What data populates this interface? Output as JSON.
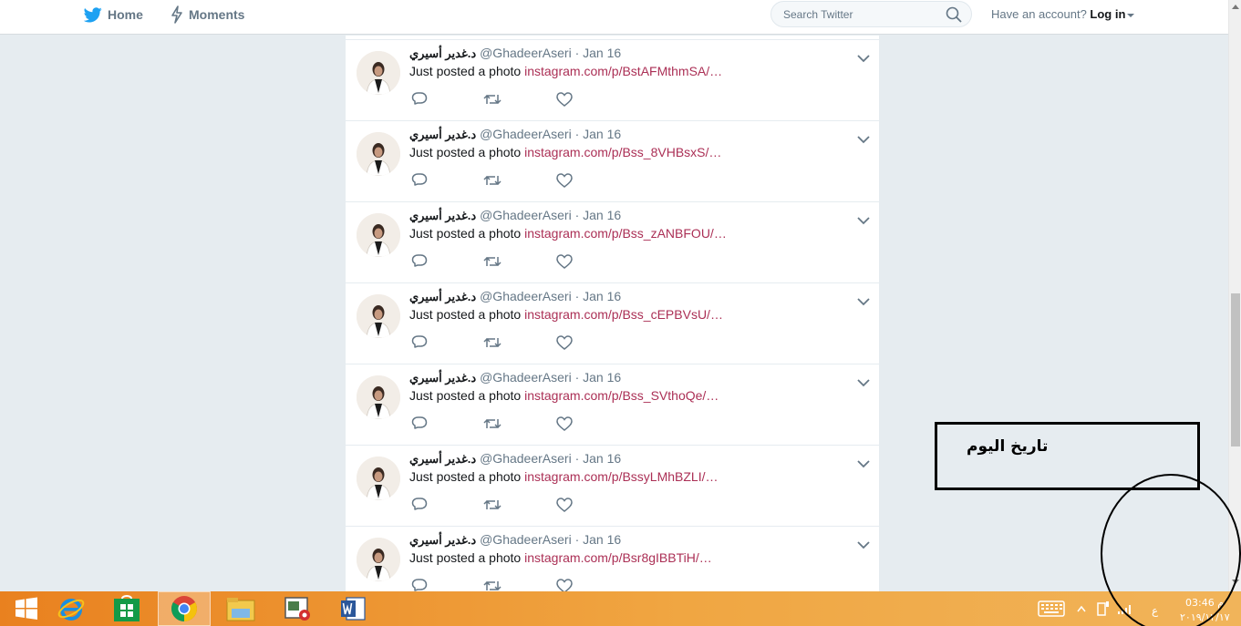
{
  "nav": {
    "home_label": "Home",
    "moments_label": "Moments",
    "search_placeholder": "Search Twitter",
    "account_prompt": "Have an account?",
    "login_label": "Log in"
  },
  "tweets": [
    {
      "name": "د.غدير أسيري",
      "handle": "@GhadeerAseri",
      "separator": "·",
      "date": "Jan 16",
      "text": "Just posted a photo",
      "link": "instagram.com/p/BstAFMthmSA/…"
    },
    {
      "name": "د.غدير أسيري",
      "handle": "@GhadeerAseri",
      "separator": "·",
      "date": "Jan 16",
      "text": "Just posted a photo",
      "link": "instagram.com/p/Bss_8VHBsxS/…"
    },
    {
      "name": "د.غدير أسيري",
      "handle": "@GhadeerAseri",
      "separator": "·",
      "date": "Jan 16",
      "text": "Just posted a photo",
      "link": "instagram.com/p/Bss_zANBFOU/…"
    },
    {
      "name": "د.غدير أسيري",
      "handle": "@GhadeerAseri",
      "separator": "·",
      "date": "Jan 16",
      "text": "Just posted a photo",
      "link": "instagram.com/p/Bss_cEPBVsU/…"
    },
    {
      "name": "د.غدير أسيري",
      "handle": "@GhadeerAseri",
      "separator": "·",
      "date": "Jan 16",
      "text": "Just posted a photo",
      "link": "instagram.com/p/Bss_SVthoQe/…"
    },
    {
      "name": "د.غدير أسيري",
      "handle": "@GhadeerAseri",
      "separator": "·",
      "date": "Jan 16",
      "text": "Just posted a photo",
      "link": "instagram.com/p/BssyLMhBZLI/…"
    },
    {
      "name": "د.غدير أسيري",
      "handle": "@GhadeerAseri",
      "separator": "·",
      "date": "Jan 16",
      "text": "Just posted a photo",
      "link": "instagram.com/p/Bsr8gIBBTiH/…"
    }
  ],
  "annotation": {
    "label": "تاريخ اليوم"
  },
  "taskbar": {
    "apps": [
      "windows-start",
      "internet-explorer",
      "windows-store",
      "google-chrome",
      "file-explorer",
      "media-app",
      "microsoft-word"
    ],
    "active_app": "google-chrome",
    "tray_icons": [
      "keyboard-icon",
      "show-hidden-icon",
      "network-adapter-icon",
      "signal-icon"
    ],
    "language": "ع",
    "time": "03:46 م",
    "date": "٢٠١٩/١٢/١٧"
  },
  "colors": {
    "link": "#ab2f55",
    "twitter_blue": "#1da1f2",
    "taskbar": "#e9811f"
  }
}
